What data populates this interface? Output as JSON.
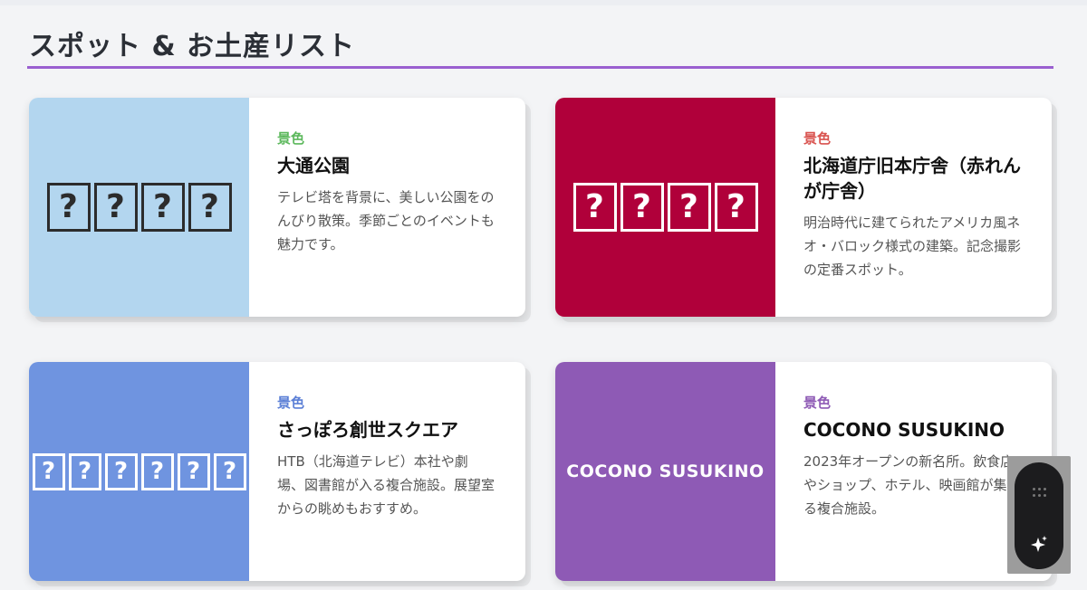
{
  "section": {
    "title": "スポット & お土産リスト"
  },
  "cards": [
    {
      "thumb_glyphs": [
        "?",
        "?",
        "?",
        "?"
      ],
      "thumb_bg": "#b3d6ef",
      "thumb_fg": "#2c2c2c",
      "category": "景色",
      "category_color": "#5cb85c",
      "name": "大通公園",
      "description": "テレビ塔を背景に、美しい公園をのんびり散策。季節ごとのイベントも魅力です。"
    },
    {
      "thumb_glyphs": [
        "?",
        "?",
        "?",
        "?"
      ],
      "thumb_bg": "#b0003a",
      "thumb_fg": "#ffffff",
      "category": "景色",
      "category_color": "#d9534f",
      "name": "北海道庁旧本庁舎（赤れんが庁舎）",
      "description": "明治時代に建てられたアメリカ風ネオ・バロック様式の建築。記念撮影の定番スポット。"
    },
    {
      "thumb_glyphs": [
        "?",
        "?",
        "?",
        "?",
        "?",
        "?"
      ],
      "thumb_bg": "#6f94e0",
      "thumb_fg": "#ffffff",
      "category": "景色",
      "category_color": "#5b7fd6",
      "name": "さっぽろ創世スクエア",
      "description": "HTB（北海道テレビ）本社や劇場、図書館が入る複合施設。展望室からの眺めもおすすめ。"
    },
    {
      "thumb_text": "COCONO SUSUKINO",
      "thumb_bg": "#8e5ab5",
      "thumb_fg": "#ffffff",
      "category": "景色",
      "category_color": "#8e5ab5",
      "name": "COCONO SUSUKINO",
      "description": "2023年オープンの新名所。飲食店やショップ、ホテル、映画館が集まる複合施設。"
    }
  ],
  "widget": {
    "grip_icon": "grip-dots-icon",
    "sparkle_icon": "sparkle-icon"
  }
}
